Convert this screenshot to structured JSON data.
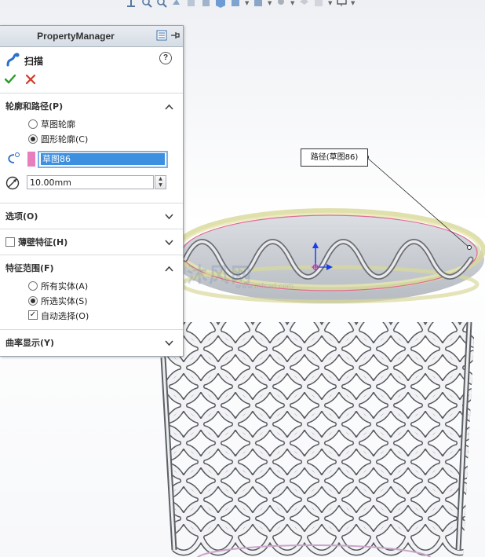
{
  "property_manager": {
    "title": "PropertyManager",
    "feature_name": "扫描",
    "help_glyph": "?",
    "sections": {
      "profile_path": {
        "title": "轮廓和路径(P)",
        "options": [
          {
            "label": "草图轮廓",
            "selected": false
          },
          {
            "label": "圆形轮廓(C)",
            "selected": true
          }
        ],
        "profile_value": "草图86",
        "diameter_value": "10.00mm"
      },
      "options": {
        "title": "选项(O)"
      },
      "thin_feature": {
        "title": "薄壁特征(H)",
        "checked": false
      },
      "feature_scope": {
        "title": "特征范围(F)",
        "options": [
          {
            "label": "所有实体(A)",
            "selected": false
          },
          {
            "label": "所选实体(S)",
            "selected": true
          }
        ],
        "auto_select": {
          "label": "自动选择(O)",
          "checked": true
        }
      },
      "curvature_display": {
        "title": "曲率显示(Y)"
      }
    }
  },
  "viewport": {
    "callout_label": "路径(草图86)",
    "watermark": "沐风网",
    "watermark_sub": "www.mfcad.com"
  },
  "colors": {
    "accept": "#2a9d2a",
    "cancel": "#d23a2a",
    "selection": "#3d8fe0",
    "profile_swatch": "#e87fbd",
    "basket": "#f2f2f4",
    "rim_glow": "#d8d89a"
  },
  "toolbar_icons": [
    "view-orient-icon",
    "zoom-fit-icon",
    "zoom-area-icon",
    "previous-view-icon",
    "section-view-icon",
    "view-settings-icon",
    "display-style-icon",
    "hide-show-icon",
    "edit-appearance-icon",
    "apply-scene-icon",
    "view-setting-icon",
    "monitor-icon"
  ]
}
